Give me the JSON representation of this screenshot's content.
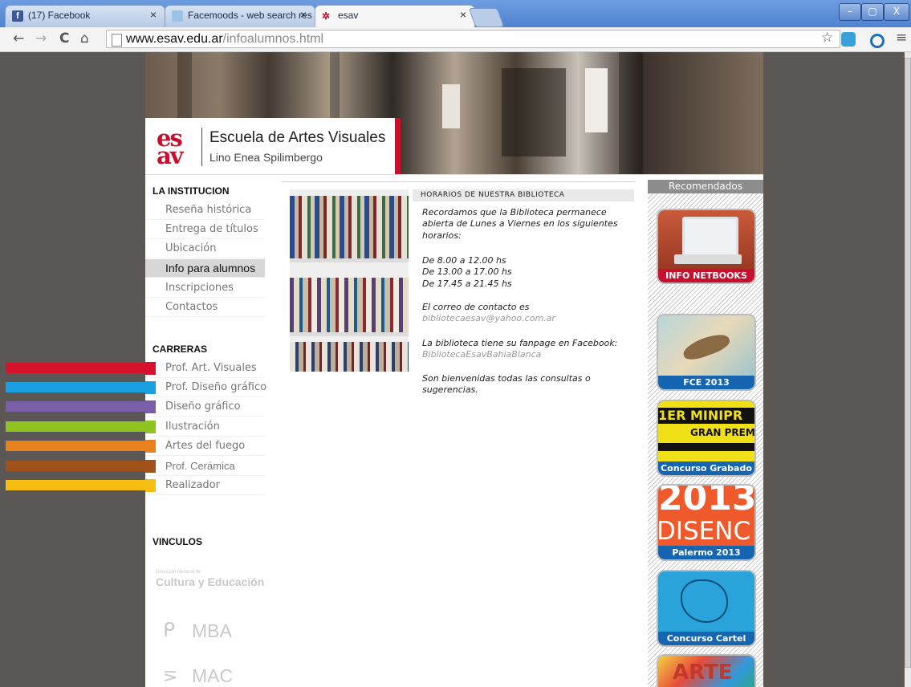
{
  "browser": {
    "tabs": [
      {
        "label": "(17) Facebook",
        "close": "×"
      },
      {
        "label": "Facemoods - web search res",
        "close": "×"
      },
      {
        "label": "esav",
        "close": "×"
      }
    ],
    "url_domain": "www.esav.edu.ar",
    "url_path": "/infoalumnos.html",
    "window_buttons": {
      "minimize": "–",
      "maximize": "▢",
      "close": "X"
    },
    "nav": {
      "back": "←",
      "forward": "→",
      "reload": "C",
      "home": "⌂",
      "star": "☆",
      "menu": "≡"
    }
  },
  "header": {
    "logo_top": "es",
    "logo_bottom": "av",
    "school_name": "Escuela de Artes Visuales",
    "school_sub": "Lino Enea Spilimbergo"
  },
  "sidebar": {
    "institucion_title": "LA INSTITUCION",
    "institucion_items": [
      {
        "label": "Reseña histórica"
      },
      {
        "label": "Entrega de títulos"
      },
      {
        "label": "Ubicación"
      },
      {
        "label": "Info para alumnos"
      },
      {
        "label": "Inscripciones"
      },
      {
        "label": "Contactos"
      }
    ],
    "carreras_title": "CARRERAS",
    "carreras_items": [
      {
        "label": "Prof. Art. Visuales",
        "color": "#d6122c"
      },
      {
        "label": "Prof. Diseño gráfico",
        "color": "#1aa0e0"
      },
      {
        "label": "Diseño gráfico",
        "color": "#7b5ea8"
      },
      {
        "label": "Ilustración",
        "color": "#8fc31f"
      },
      {
        "label": "Artes del fuego",
        "color": "#e8811c"
      },
      {
        "label": "Prof. Cerámica",
        "color": "#a0521a"
      },
      {
        "label": "Realizador",
        "color": "#f5be10"
      }
    ],
    "vinculos_title": "VINCULOS",
    "vinculos": [
      {
        "small": "Dirección General de",
        "big": "Cultura y Educación"
      },
      {
        "big": "MBA"
      },
      {
        "big": "MAC"
      }
    ]
  },
  "article": {
    "title": "HORARIOS DE NUESTRA BIBLIOTECA",
    "intro": [
      "Recordamos que la Biblioteca permanece",
      "abierta de Lunes a Viernes en los siguientes",
      "horarios:"
    ],
    "hours": [
      "De 8.00 a 12.00 hs",
      "De 13.00 a 17.00 hs",
      "De 17.45 a 21.45 hs"
    ],
    "contact_label": "El correo de contacto es",
    "contact_email": "bibliotecaesav@yahoo.com.ar",
    "fanpage_label": "La biblioteca tiene su fanpage en Facebook:",
    "fanpage_name": "BibliotecaEsavBahiaBlanca",
    "closing": [
      "Son bienvenidas todas las consultas o",
      "sugerencias."
    ]
  },
  "recomendados": {
    "title": "Recomendados",
    "items": [
      {
        "label": "INFO NETBOOKS",
        "bar": "#c8102e"
      },
      {
        "label": "FCE 2013",
        "bar": "#1565b0"
      },
      {
        "label": "Concurso Grabado",
        "bar": "#1565b0",
        "art_text": [
          "1ER MINIPR",
          "GRAN PREM"
        ]
      },
      {
        "label": "Palermo 2013",
        "bar": "#1565b0",
        "art_text": [
          "2013",
          "DISENC"
        ]
      },
      {
        "label": "Concurso Cartel",
        "bar": "#1565b0"
      },
      {
        "label": "",
        "art_text": [
          "ARTE"
        ]
      }
    ]
  }
}
